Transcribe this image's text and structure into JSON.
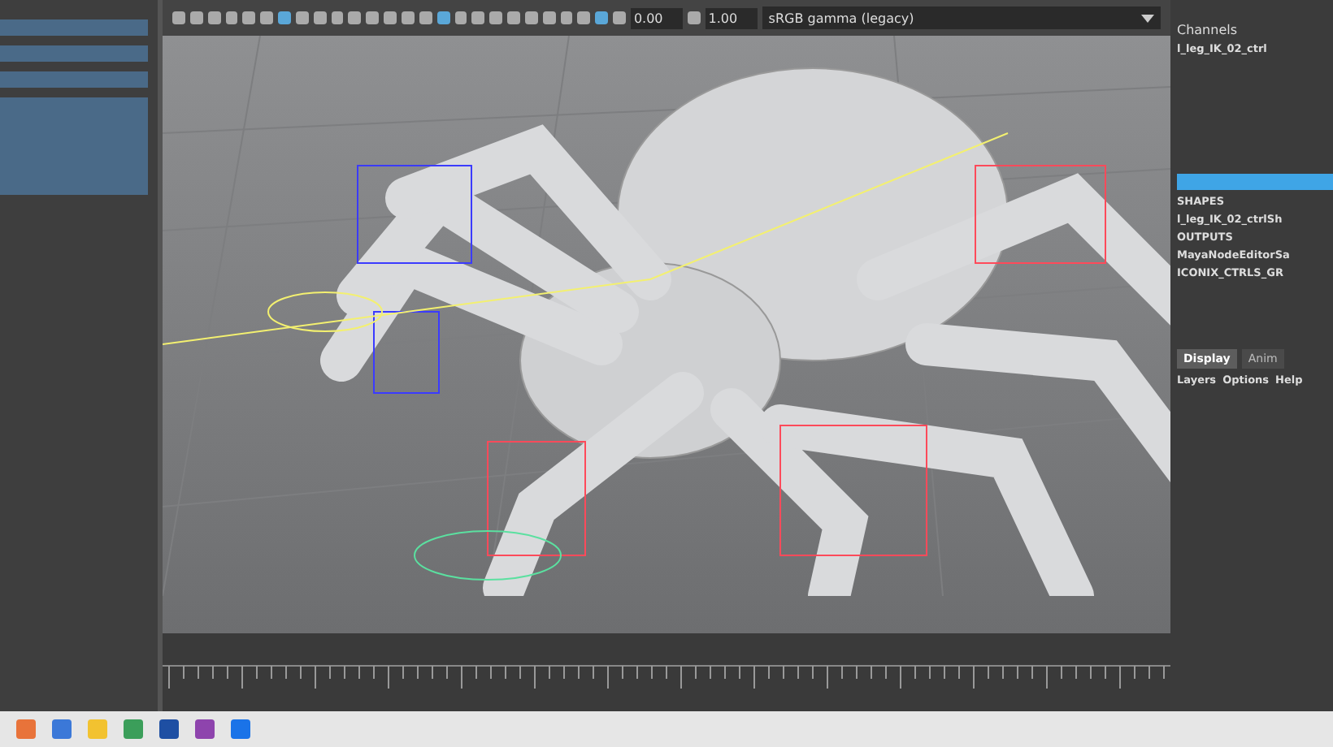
{
  "toolbar": {
    "exposure": "0.00",
    "gamma": "1.00",
    "color_space": "sRGB gamma (legacy)"
  },
  "channel_box": {
    "title": "Channels",
    "object": "l_leg_IK_02_ctrl",
    "sections": [
      {
        "heading": "SHAPES",
        "items": [
          "l_leg_IK_02_ctrlSh"
        ]
      },
      {
        "heading": "OUTPUTS",
        "items": [
          "MayaNodeEditorSa",
          "ICONIX_CTRLS_GR"
        ]
      }
    ]
  },
  "layer_editor": {
    "tabs": [
      {
        "label": "Display",
        "selected": true
      },
      {
        "label": "Anim",
        "selected": false
      }
    ],
    "menu": [
      "Layers",
      "Options",
      "Help"
    ]
  }
}
